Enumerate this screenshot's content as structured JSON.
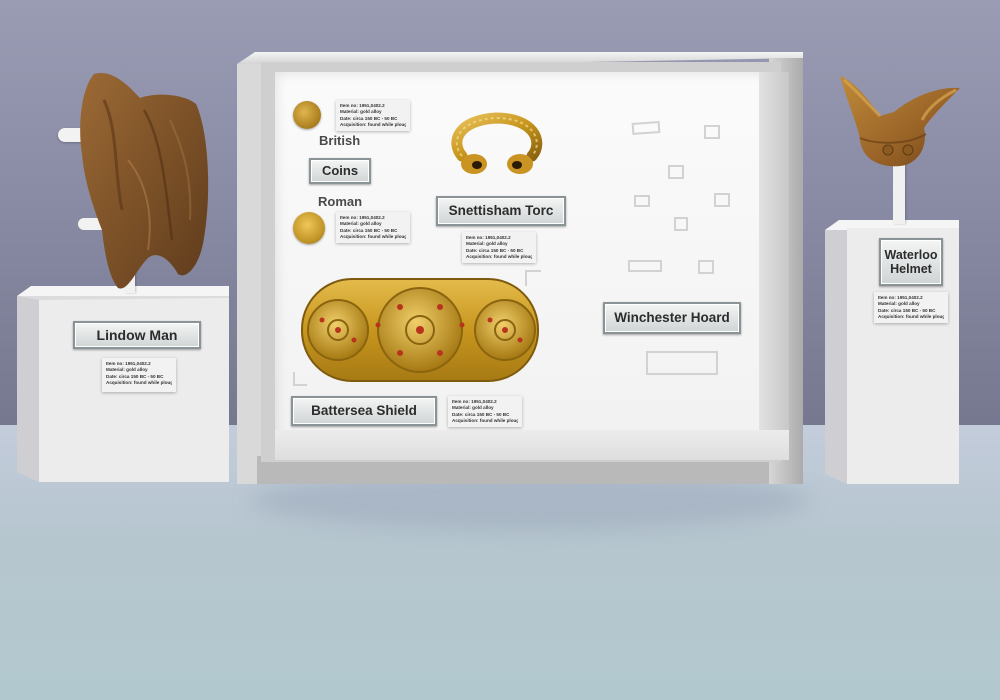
{
  "colors": {
    "wall": "#8a8ca6",
    "floor": "#b6c6cf",
    "gold": "#c9961e",
    "bronze": "#8a5a26"
  },
  "item_info": {
    "item_no": "Item no: 1951,0402.2",
    "material": "Material: gold alloy",
    "date": "Date: circa 150 BC - 50 BC",
    "acquisition": "Acquisition: found while ploughing"
  },
  "exhibits": {
    "lindow_man": {
      "label": "Lindow Man"
    },
    "waterloo_helmet": {
      "label_line1": "Waterloo",
      "label_line2": "Helmet"
    },
    "coins": {
      "label": "Coins",
      "group_top": "British",
      "group_bottom": "Roman"
    },
    "snettisham_torc": {
      "label": "Snettisham Torc"
    },
    "battersea_shield": {
      "label": "Battersea Shield"
    },
    "winchester_hoard": {
      "label": "Winchester Hoard"
    }
  }
}
